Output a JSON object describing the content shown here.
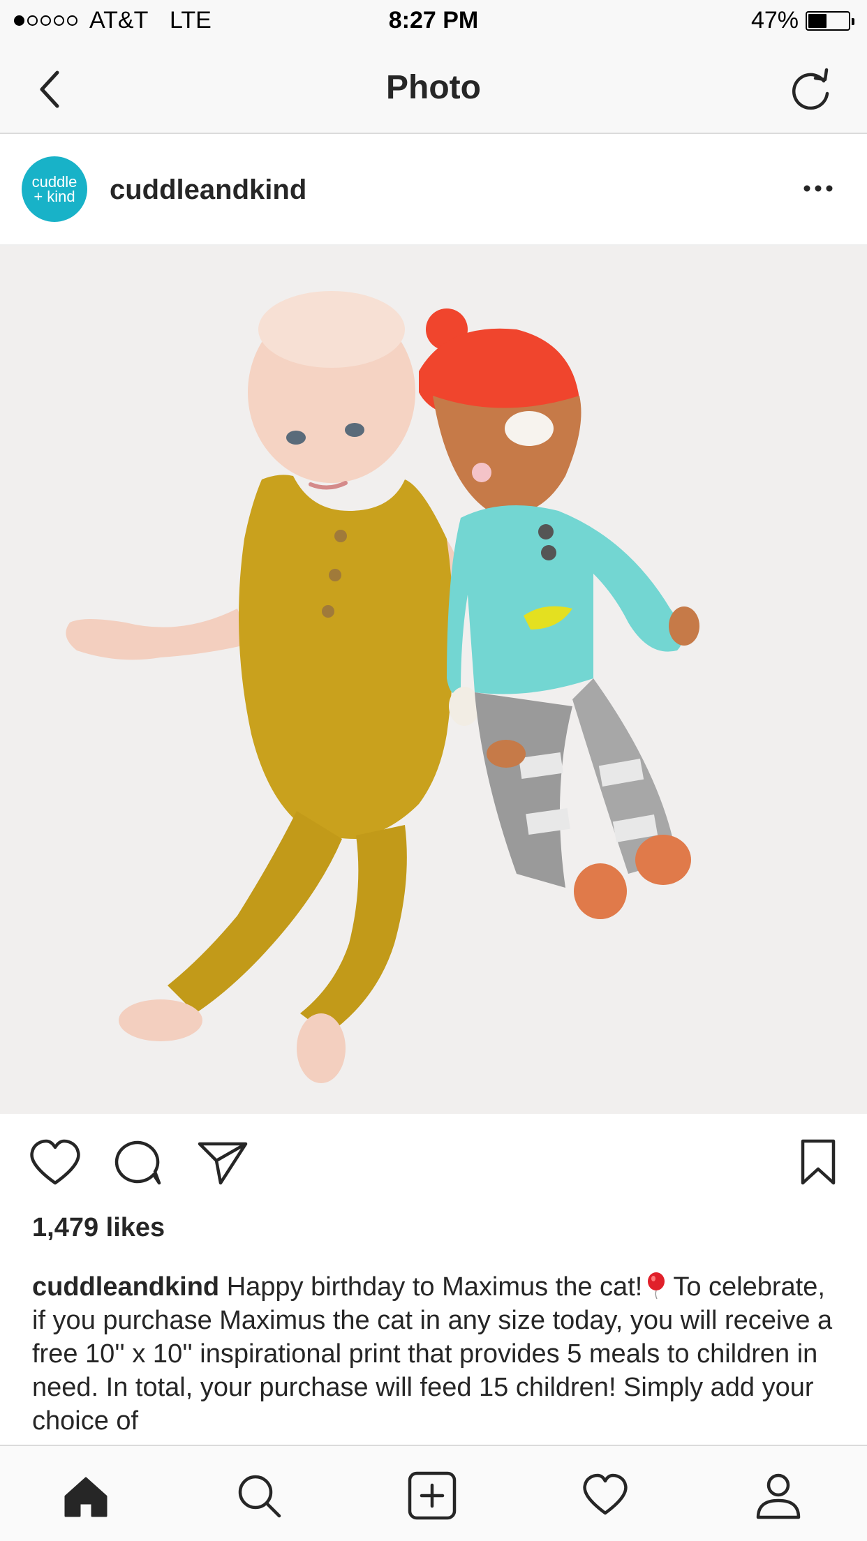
{
  "status_bar": {
    "carrier": "AT&T",
    "network": "LTE",
    "time": "8:27 PM",
    "battery_percent": "47%",
    "battery_level": 0.47,
    "signal_bars_filled": 1,
    "signal_bars_total": 5
  },
  "nav": {
    "title": "Photo",
    "back_icon": "chevron-left-icon",
    "refresh_icon": "refresh-icon"
  },
  "post": {
    "avatar_text_line1": "cuddle",
    "avatar_text_line2": "+ kind",
    "avatar_color": "#18b2c8",
    "username": "cuddleandkind",
    "more_icon": "more-horizontal-icon",
    "likes": "1,479 likes",
    "caption_user": "cuddleandkind",
    "caption_part1": "Happy birthday to Maximus the cat!",
    "caption_part2": "To celebrate, if you purchase Maximus the cat in any size today, you will receive a free 10'' x 10'' inspirational print that provides 5 meals to children in need. In total, your purchase will feed 15 children! Simply add your choice of"
  },
  "tabs": [
    {
      "name": "home",
      "icon": "home-icon"
    },
    {
      "name": "search",
      "icon": "search-icon"
    },
    {
      "name": "add",
      "icon": "add-post-icon"
    },
    {
      "name": "activity",
      "icon": "heart-icon"
    },
    {
      "name": "profile",
      "icon": "profile-icon"
    }
  ],
  "colors": {
    "text": "#262626",
    "divider": "#dbdbdb",
    "bar_background": "#f8f8f8"
  }
}
